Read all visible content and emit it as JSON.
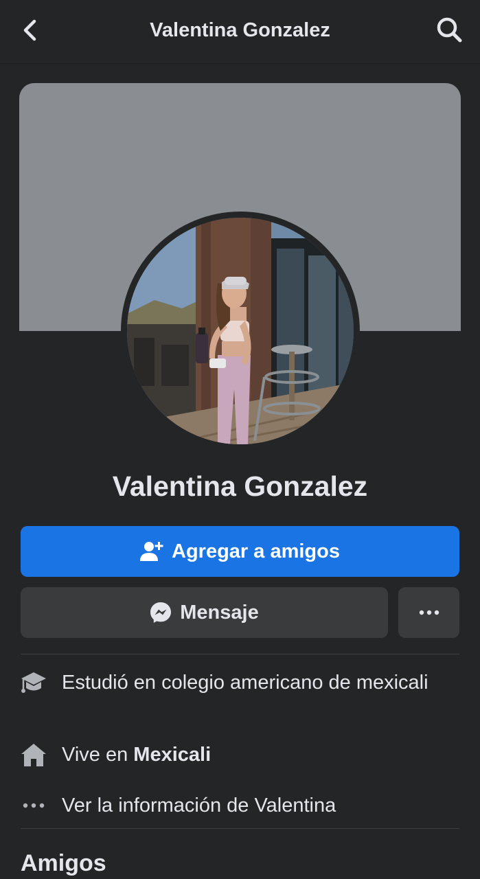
{
  "header": {
    "title": "Valentina Gonzalez",
    "back_icon": "chevron-left-icon",
    "search_icon": "search-icon"
  },
  "profile": {
    "name": "Valentina Gonzalez",
    "cover_color": "#8a8d91"
  },
  "actions": {
    "add_friend_label": "Agregar a amigos",
    "add_friend_icon": "add-friend-icon",
    "message_label": "Mensaje",
    "message_icon": "messenger-icon",
    "more_icon": "more-icon"
  },
  "intro": {
    "education": "Estudió en colegio americano de mexicali",
    "lives_prefix": "Vive en",
    "lives_city": "Mexicali",
    "see_info": "Ver la información de Valentina"
  },
  "friends": {
    "title": "Amigos"
  },
  "colors": {
    "background": "#242526",
    "primary_button": "#1b74e4",
    "secondary_button": "#3a3b3c",
    "text": "#e4e6eb"
  }
}
